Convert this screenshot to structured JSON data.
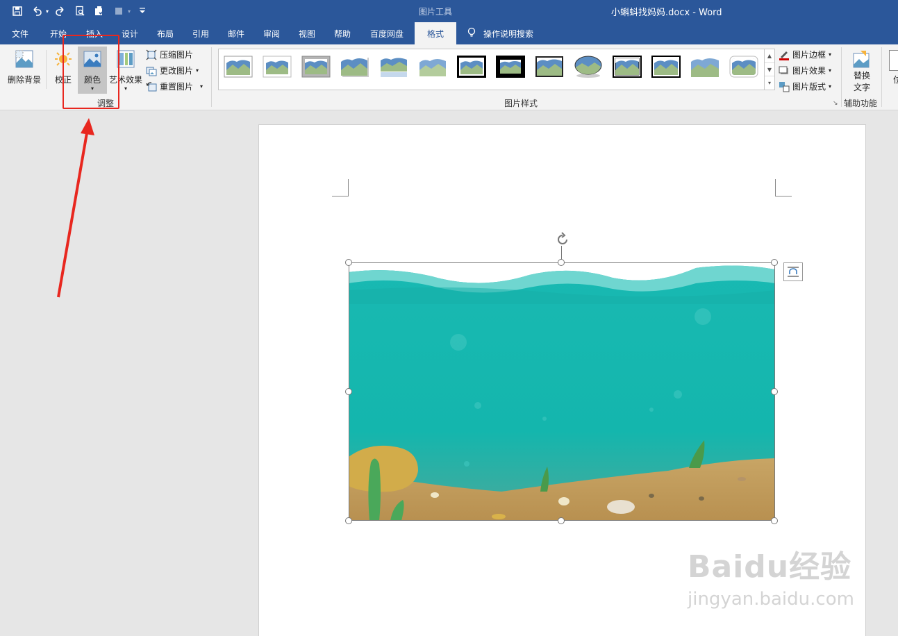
{
  "window": {
    "title": "小蝌蚪找妈妈.docx  -  Word",
    "context_tool_label": "图片工具"
  },
  "quick_access": [
    "save-icon",
    "undo-icon",
    "redo-icon",
    "print-preview-icon",
    "spelling-icon",
    "touch-mode-icon",
    "customize-icon"
  ],
  "tabs": [
    {
      "label": "文件"
    },
    {
      "label": "开始"
    },
    {
      "label": "插入"
    },
    {
      "label": "设计"
    },
    {
      "label": "布局"
    },
    {
      "label": "引用"
    },
    {
      "label": "邮件"
    },
    {
      "label": "审阅"
    },
    {
      "label": "视图"
    },
    {
      "label": "帮助"
    },
    {
      "label": "百度网盘"
    },
    {
      "label": "格式",
      "active": true
    }
  ],
  "tell_me": "操作说明搜索",
  "ribbon": {
    "remove_bg": "删除背景",
    "corrections": "校正",
    "color": "颜色",
    "artistic": "艺术效果",
    "compress": "压缩图片",
    "change": "更改图片",
    "reset": "重置图片",
    "adjust_group": "调整",
    "styles_group": "图片样式",
    "border": "图片边框",
    "effects": "图片效果",
    "layout": "图片版式",
    "alt_text_1": "替换",
    "alt_text_2": "文字",
    "accessibility_group": "辅助功能",
    "cut_label": "位"
  },
  "colors": {
    "title_bar": "#2b579a",
    "ribbon_bg": "#f3f3f3",
    "annotation_red": "#e8271f",
    "water": "#17b5ad",
    "sand": "#c9a96a"
  },
  "watermark": {
    "main": "Baidu经验",
    "sub": "jingyan.baidu.com"
  }
}
